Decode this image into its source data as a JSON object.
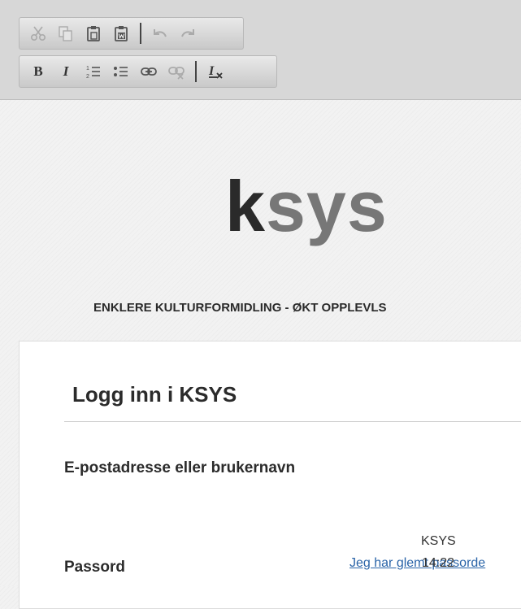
{
  "toolbar": {
    "row1": [
      {
        "name": "cut-icon",
        "title": "Cut"
      },
      {
        "name": "copy-icon",
        "title": "Copy"
      },
      {
        "name": "paste-icon",
        "title": "Paste"
      },
      {
        "name": "paste-from-word-icon",
        "title": "Paste from Word"
      },
      {
        "name": "undo-icon",
        "title": "Undo"
      },
      {
        "name": "redo-icon",
        "title": "Redo"
      }
    ],
    "row2": {
      "bold_label": "B",
      "italic_label": "I",
      "items": [
        {
          "name": "numbered-list-icon"
        },
        {
          "name": "bulleted-list-icon"
        },
        {
          "name": "link-icon"
        },
        {
          "name": "unlink-icon"
        },
        {
          "name": "remove-format-icon"
        }
      ]
    },
    "colors": {
      "background": "#d7d7d7",
      "icon": "#555555",
      "disabled_icon": "#aaaaaa"
    }
  },
  "brand": {
    "logo_first": "k",
    "logo_rest": "sys",
    "tagline": "ENKLERE KULTURFORMIDLING - ØKT OPPLEVLS"
  },
  "login": {
    "title": "Logg inn i KSYS",
    "username_label": "E-postadresse eller brukernavn",
    "password_label": "Passord",
    "forgot_link": "Jeg har glemt passorde"
  },
  "footer": {
    "brand": "KSYS",
    "time": "14:22"
  },
  "colors": {
    "link": "#2a64a8",
    "text": "#2b2b2b",
    "logo_dark": "#2a2a2a",
    "logo_light": "#777777"
  }
}
